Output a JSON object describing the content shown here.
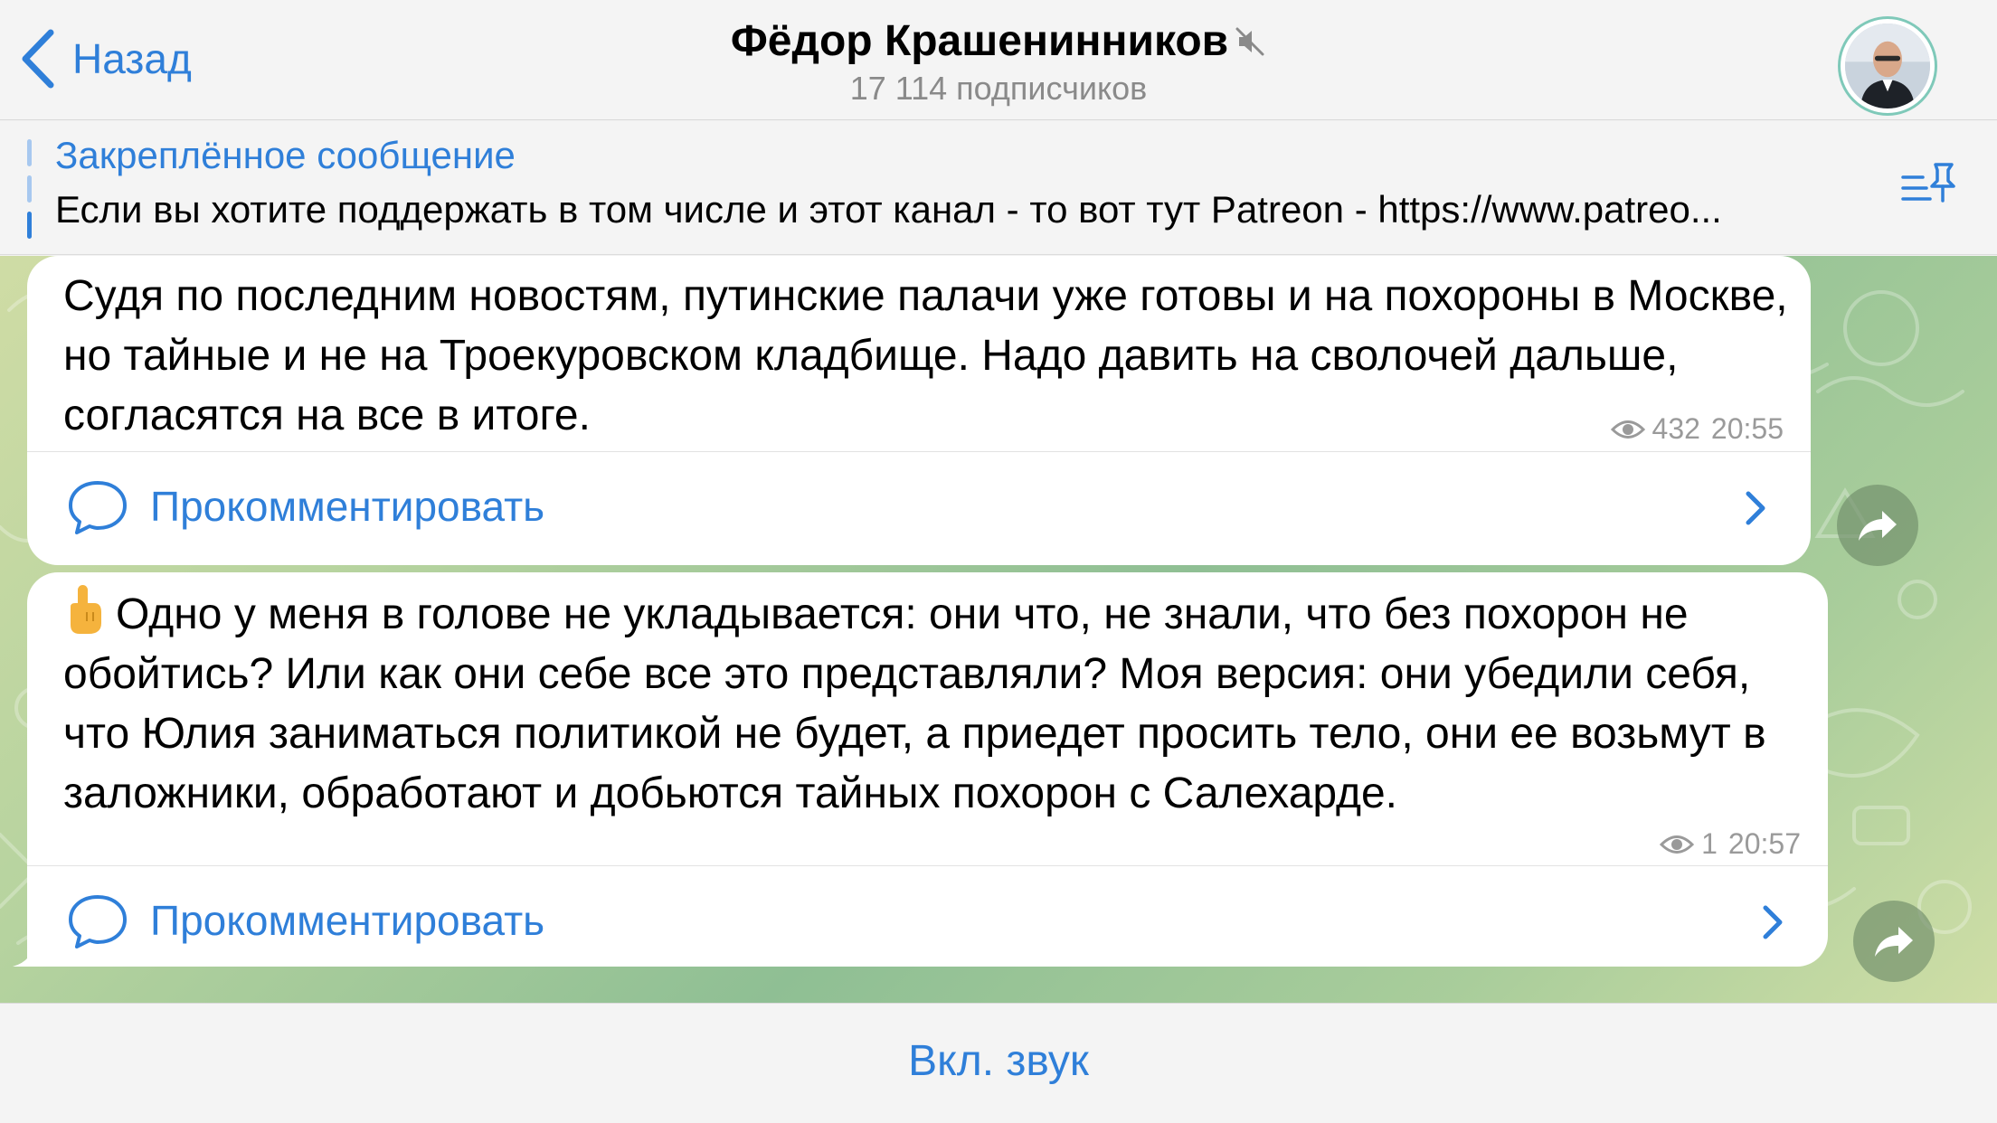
{
  "header": {
    "back_label": "Назад",
    "title": "Фёдор Крашенинников",
    "subtitle": "17 114 подписчиков"
  },
  "pinned": {
    "title": "Закреплённое сообщение",
    "text": "Если вы хотите поддержать в том числе и этот канал - то вот тут Patreon - https://www.patreo..."
  },
  "messages": [
    {
      "text": "Судя по последним новостям, путинские палачи уже готовы и на похороны в Москве, но тайные и не на Троекуровском кладбище. Надо давить на сволочей дальше, согласятся на все в итоге.",
      "views": "432",
      "time": "20:55",
      "comment_label": "Прокомментировать"
    },
    {
      "text": "Одно у меня в голове не укладывается: они что, не знали, что без похорон не обойтись? Или как они себе все это представляли? Моя версия: они убедили себя, что Юлия заниматься политикой не будет, а приедет просить тело, они ее возьмут в заложники, обработают и добьются тайных похорон с Салехарде.",
      "emoji": "pointing-up-hand",
      "views": "1",
      "time": "20:57",
      "comment_label": "Прокомментировать"
    }
  ],
  "bottom": {
    "unmute_label": "Вкл. звук"
  },
  "colors": {
    "accent": "#2f7fd9",
    "bubble": "#ffffff",
    "meta_text": "#9a9a9a"
  },
  "icons": [
    "chevron-left-icon",
    "muted-speaker-icon",
    "pin-list-icon",
    "comment-bubble-icon",
    "chevron-right-icon",
    "share-arrow-icon",
    "eye-icon"
  ]
}
